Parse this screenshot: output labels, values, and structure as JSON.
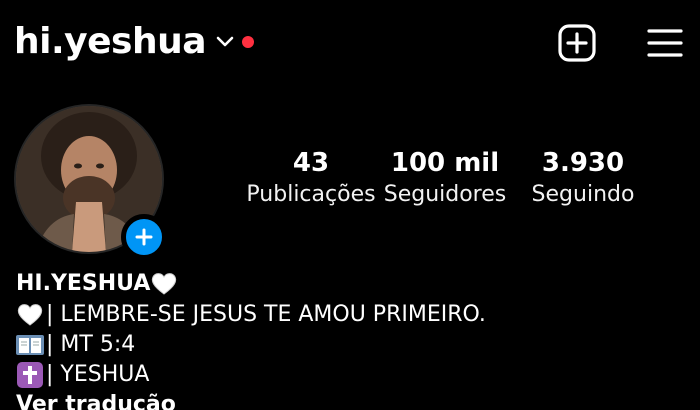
{
  "header": {
    "username": "hi.yeshua",
    "icons": {
      "chevron": "chevron-down-icon",
      "notification": "notification-dot-icon",
      "create": "plus-square-icon",
      "menu": "hamburger-menu-icon"
    },
    "accent_color": "#ff3040"
  },
  "profile": {
    "avatar": "profile-avatar",
    "add_story_color": "#0095f6"
  },
  "stats": [
    {
      "value": "43",
      "label": "Publicações"
    },
    {
      "value": "100 mil",
      "label": "Seguidores"
    },
    {
      "value": "3.930",
      "label": "Seguindo"
    }
  ],
  "bio": {
    "display_name": "HI.YESHUA",
    "lines": [
      {
        "icon": "white-heart-icon",
        "text": "| LEMBRE-SE JESUS TE AMOU PRIMEIRO."
      },
      {
        "icon": "open-book-icon",
        "text": "| MT 5:4"
      },
      {
        "icon": "latin-cross-icon",
        "text": "| YESHUA"
      }
    ],
    "see_translation": "Ver tradução"
  }
}
